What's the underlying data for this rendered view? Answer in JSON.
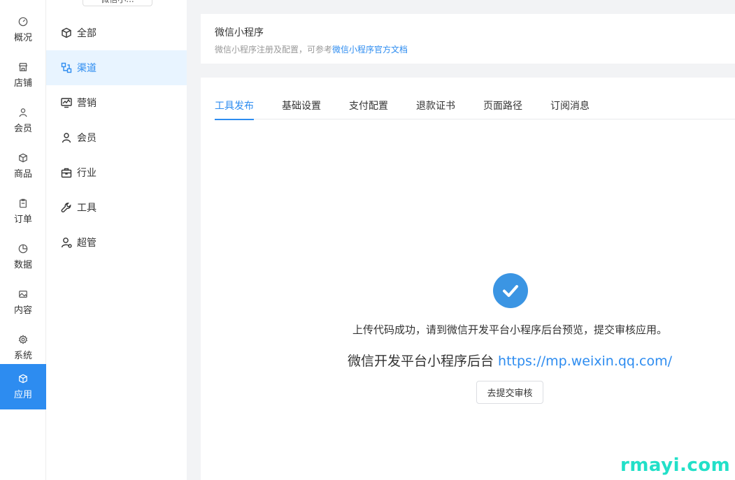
{
  "rail": {
    "items": [
      {
        "label": "概况",
        "icon": "dashboard-icon"
      },
      {
        "label": "店铺",
        "icon": "store-icon"
      },
      {
        "label": "会员",
        "icon": "user-icon"
      },
      {
        "label": "商品",
        "icon": "box-icon"
      },
      {
        "label": "订单",
        "icon": "clipboard-icon"
      },
      {
        "label": "数据",
        "icon": "pie-chart-icon"
      },
      {
        "label": "内容",
        "icon": "image-icon"
      },
      {
        "label": "系统",
        "icon": "gear-icon"
      },
      {
        "label": "应用",
        "icon": "cube-icon",
        "active": true
      }
    ],
    "active_color": "#2d8cf0"
  },
  "submenu": {
    "title": "微信小...",
    "items": [
      {
        "label": "全部",
        "icon": "cube-icon"
      },
      {
        "label": "渠道",
        "icon": "channel-icon",
        "active": true
      },
      {
        "label": "营销",
        "icon": "marketing-chart-icon"
      },
      {
        "label": "会员",
        "icon": "user-icon"
      },
      {
        "label": "行业",
        "icon": "briefcase-icon"
      },
      {
        "label": "工具",
        "icon": "wrench-icon"
      },
      {
        "label": "超管",
        "icon": "admin-user-icon"
      }
    ]
  },
  "header": {
    "title": "微信小程序",
    "subtitle_prefix": "微信小程序注册及配置，可参考",
    "subtitle_link": "微信小程序官方文档"
  },
  "tabs": [
    {
      "label": "工具发布",
      "active": true
    },
    {
      "label": "基础设置"
    },
    {
      "label": "支付配置"
    },
    {
      "label": "退款证书"
    },
    {
      "label": "页面路径"
    },
    {
      "label": "订阅消息"
    }
  ],
  "result": {
    "message": "上传代码成功，请到微信开发平台小程序后台预览，提交审核应用。",
    "platform_label": "微信开发平台小程序后台",
    "platform_url": "https://mp.weixin.qq.com/",
    "submit_label": "去提交审核",
    "icon": "check-circle-icon",
    "icon_color": "#3b95e3"
  },
  "watermark": "rmayi.com"
}
